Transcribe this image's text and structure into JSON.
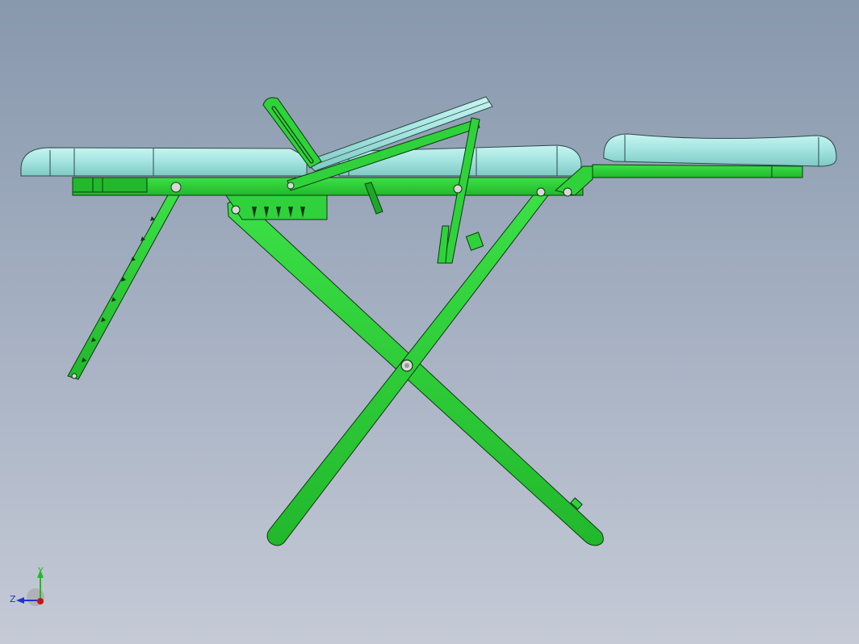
{
  "viewport": {
    "background_top": "#8898ad",
    "background_bottom": "#c5cad6"
  },
  "model": {
    "part_color": "#2fd23a",
    "part_edge": "#0c3a10",
    "cushion_color": "#a6e6e2",
    "cushion_edge": "#2c4a4a",
    "pin_color": "#d8d8d8"
  },
  "triad": {
    "y_label": "Y",
    "z_label": "Z",
    "y_color": "#22bb22",
    "z_color": "#2233cc",
    "x_color": "#cc1111"
  }
}
